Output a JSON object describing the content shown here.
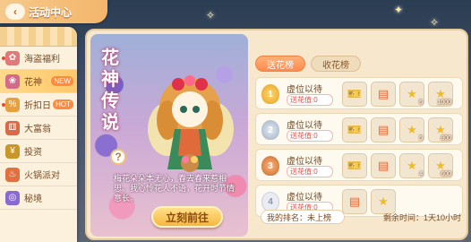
{
  "header": {
    "title": "活动中心",
    "back_icon": "chevron-left-icon"
  },
  "sidebar": {
    "items": [
      {
        "label": "海盗福利",
        "icon": "gift-icon",
        "color": "#e07a7a",
        "dot": true
      },
      {
        "label": "花神",
        "icon": "flower-icon",
        "color": "#d46a8a",
        "badge": "NEW",
        "active": true
      },
      {
        "label": "折扣日",
        "icon": "tag-icon",
        "color": "#e6a040",
        "badge": "HOT",
        "dot": true
      },
      {
        "label": "大富翁",
        "icon": "dice-icon",
        "color": "#d86a4a"
      },
      {
        "label": "投资",
        "icon": "coin-icon",
        "color": "#c8962a"
      },
      {
        "label": "火锅派对",
        "icon": "hotpot-icon",
        "color": "#e07040"
      },
      {
        "label": "秘境",
        "icon": "portal-icon",
        "color": "#8a6ad0"
      }
    ]
  },
  "hero": {
    "title_chars": [
      "花",
      "神",
      "传",
      "说"
    ],
    "description": "梅花朵朵本无心，春去春来惹相思。我心怜花人不语，花开时节情意长。",
    "go_button": "立刻前往",
    "help_label": "?"
  },
  "tabs": [
    {
      "label": "送花榜",
      "active": true
    },
    {
      "label": "收花榜",
      "active": false
    }
  ],
  "ranking": [
    {
      "rank": "1",
      "medal": "gold",
      "name": "虚位以待",
      "value_label": "送花值:",
      "value": "0",
      "rewards": [
        {
          "icon": "ticket-icon",
          "amount": ""
        },
        {
          "icon": "card-icon",
          "amount": ""
        },
        {
          "icon": "star-icon",
          "amount": "6"
        },
        {
          "icon": "star-icon",
          "amount": "1000"
        }
      ]
    },
    {
      "rank": "2",
      "medal": "silver",
      "name": "虚位以待",
      "value_label": "送花值:",
      "value": "0",
      "rewards": [
        {
          "icon": "ticket-icon",
          "amount": ""
        },
        {
          "icon": "card-icon",
          "amount": ""
        },
        {
          "icon": "star-icon",
          "amount": "5"
        },
        {
          "icon": "star-icon",
          "amount": "800"
        }
      ]
    },
    {
      "rank": "3",
      "medal": "bronze",
      "name": "虚位以待",
      "value_label": "送花值:",
      "value": "0",
      "rewards": [
        {
          "icon": "ticket-icon",
          "amount": ""
        },
        {
          "icon": "card-icon",
          "amount": ""
        },
        {
          "icon": "star-icon",
          "amount": "4"
        },
        {
          "icon": "star-icon",
          "amount": "600"
        }
      ]
    },
    {
      "rank": "4",
      "medal": "plain",
      "name": "虚位以待",
      "value_label": "送花值:",
      "value": "0",
      "rewards": [
        {
          "icon": "card-icon",
          "amount": ""
        },
        {
          "icon": "star-icon",
          "amount": ""
        }
      ]
    }
  ],
  "footer": {
    "my_rank_label": "我的排名：",
    "my_rank_value": "未上榜",
    "time_label": "剩余时间：",
    "time_value": "1天10小时"
  },
  "colors": {
    "accent": "#ff8a4d",
    "panel": "#f7e7cc"
  }
}
